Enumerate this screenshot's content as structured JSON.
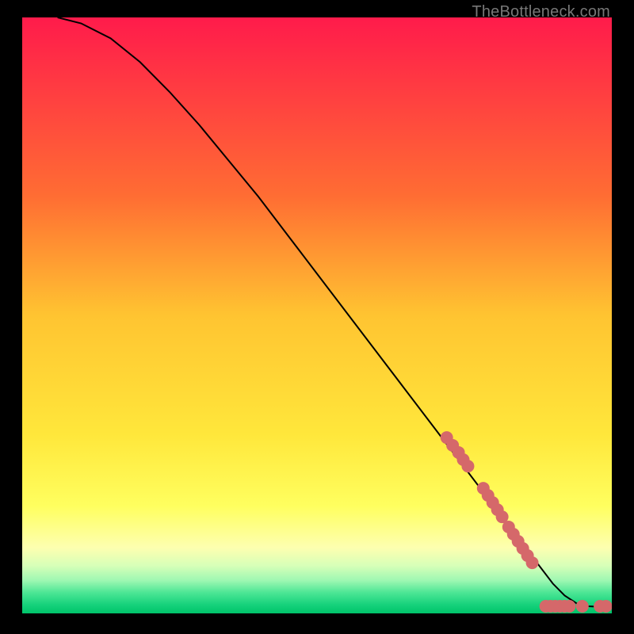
{
  "watermark": "TheBottleneck.com",
  "chart_data": {
    "type": "line",
    "title": "",
    "xlabel": "",
    "ylabel": "",
    "xlim": [
      0,
      100
    ],
    "ylim": [
      0,
      100
    ],
    "grid": false,
    "legend": false,
    "background_gradient": {
      "stops": [
        {
          "offset": 0.0,
          "color": "#ff1b4b"
        },
        {
          "offset": 0.3,
          "color": "#ff6d33"
        },
        {
          "offset": 0.5,
          "color": "#ffc431"
        },
        {
          "offset": 0.7,
          "color": "#ffe73b"
        },
        {
          "offset": 0.82,
          "color": "#ffff5f"
        },
        {
          "offset": 0.89,
          "color": "#fdffb0"
        },
        {
          "offset": 0.92,
          "color": "#d7ffb8"
        },
        {
          "offset": 0.945,
          "color": "#9df7b2"
        },
        {
          "offset": 0.965,
          "color": "#4de695"
        },
        {
          "offset": 0.985,
          "color": "#17d27c"
        },
        {
          "offset": 1.0,
          "color": "#00c46a"
        }
      ]
    },
    "series": [
      {
        "name": "curve",
        "type": "line",
        "color": "#000000",
        "x": [
          6,
          10,
          15,
          20,
          25,
          30,
          35,
          40,
          45,
          50,
          55,
          60,
          65,
          70,
          75,
          80,
          82,
          84,
          86,
          88,
          90,
          92,
          94,
          96,
          98,
          100
        ],
        "y": [
          100,
          99,
          96.5,
          92.5,
          87.5,
          82,
          76,
          70,
          63.5,
          57,
          50.5,
          44,
          37.5,
          31,
          24.5,
          18,
          15.4,
          12.8,
          10.2,
          7.6,
          5.0,
          3.0,
          1.7,
          1.2,
          1.1,
          1.1
        ]
      },
      {
        "name": "markers-diagonal",
        "type": "scatter",
        "color": "#d5686a",
        "radius": 8,
        "points": [
          {
            "x": 72,
            "y": 29.5
          },
          {
            "x": 73,
            "y": 28.2
          },
          {
            "x": 74,
            "y": 27.0
          },
          {
            "x": 74.8,
            "y": 25.8
          },
          {
            "x": 75.6,
            "y": 24.7
          },
          {
            "x": 78.2,
            "y": 21.0
          },
          {
            "x": 79.0,
            "y": 19.8
          },
          {
            "x": 79.8,
            "y": 18.6
          },
          {
            "x": 80.6,
            "y": 17.4
          },
          {
            "x": 81.4,
            "y": 16.2
          },
          {
            "x": 82.5,
            "y": 14.5
          },
          {
            "x": 83.3,
            "y": 13.3
          },
          {
            "x": 84.1,
            "y": 12.1
          },
          {
            "x": 84.9,
            "y": 10.9
          },
          {
            "x": 85.7,
            "y": 9.7
          },
          {
            "x": 86.5,
            "y": 8.5
          }
        ]
      },
      {
        "name": "markers-bottom",
        "type": "scatter",
        "color": "#d5686a",
        "radius": 8,
        "points": [
          {
            "x": 88.8,
            "y": 1.2
          },
          {
            "x": 89.6,
            "y": 1.2
          },
          {
            "x": 90.4,
            "y": 1.2
          },
          {
            "x": 91.2,
            "y": 1.2
          },
          {
            "x": 92.0,
            "y": 1.2
          },
          {
            "x": 92.8,
            "y": 1.2
          },
          {
            "x": 95.0,
            "y": 1.2
          },
          {
            "x": 98.0,
            "y": 1.2
          },
          {
            "x": 99.0,
            "y": 1.2
          }
        ]
      }
    ]
  }
}
